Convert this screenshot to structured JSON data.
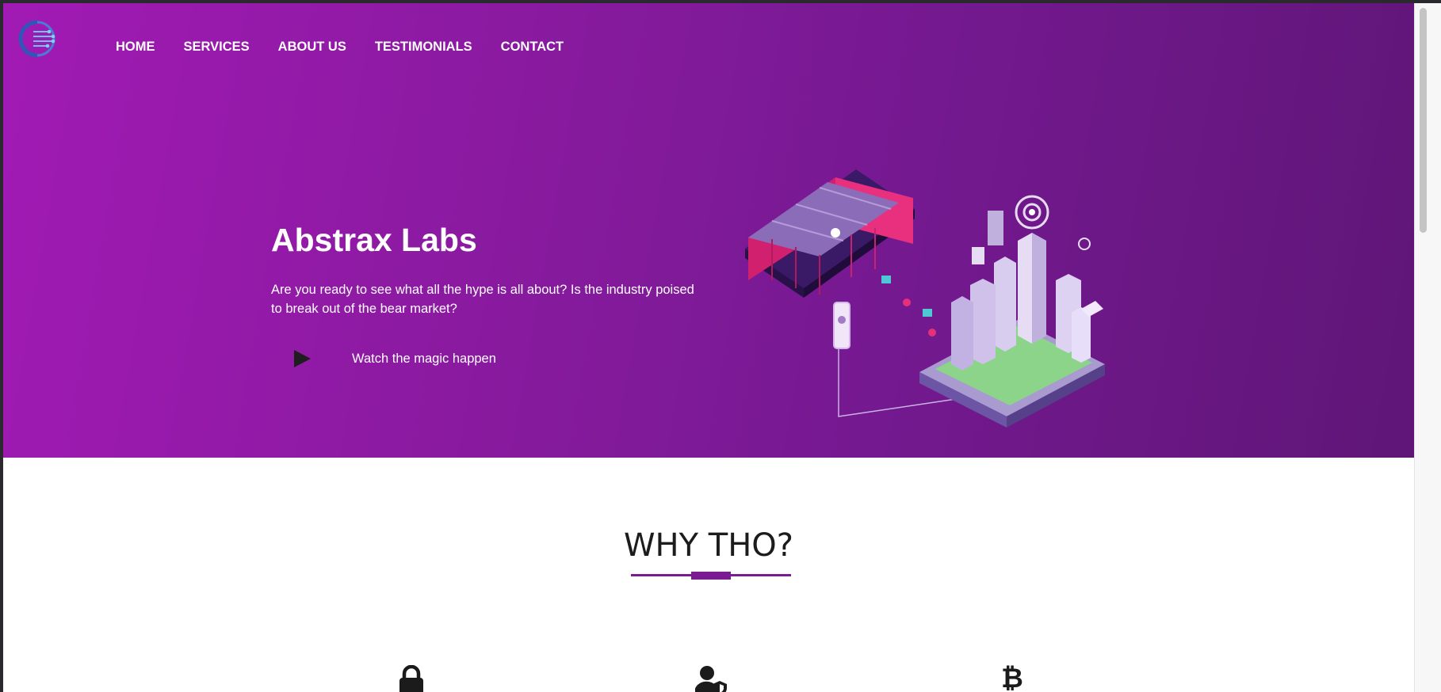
{
  "nav": {
    "items": [
      {
        "label": "HOME"
      },
      {
        "label": "SERVICES"
      },
      {
        "label": "ABOUT US"
      },
      {
        "label": "TESTIMONIALS"
      },
      {
        "label": "CONTACT"
      }
    ]
  },
  "hero": {
    "title": "Abstrax Labs",
    "subtitle": "Are you ready to see what all the hype is all about? Is the industry poised to break out of the bear market?",
    "cta_label": "Watch the magic happen"
  },
  "why": {
    "title": "WHY THO?"
  },
  "features": [
    {
      "icon": "lock-icon"
    },
    {
      "icon": "user-shield-icon"
    },
    {
      "icon": "bitcoin-icon"
    }
  ],
  "colors": {
    "hero_gradient_start": "#a11ab4",
    "hero_gradient_end": "#5f1677",
    "accent": "#7b1b92",
    "heading_text": "#1c1c1c"
  }
}
